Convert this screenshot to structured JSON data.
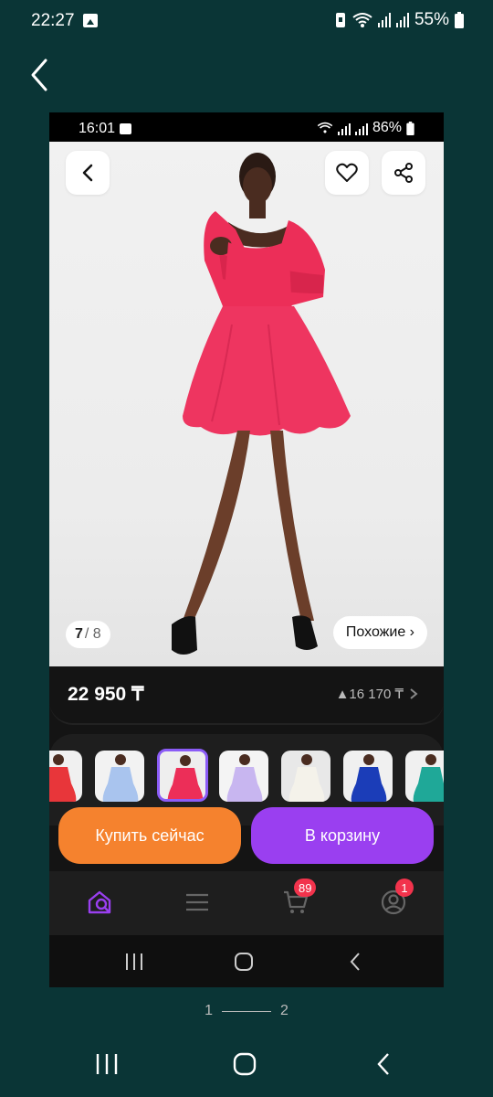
{
  "outer_status": {
    "time": "22:27",
    "battery": "55%"
  },
  "inner_status": {
    "time": "16:01",
    "battery": "86%"
  },
  "gallery": {
    "current": "7",
    "total": "/ 8",
    "similar_label": "Похожие ›"
  },
  "product": {
    "price": "22 950 ₸",
    "old_price": "▲16 170 ₸"
  },
  "actions": {
    "buy_now": "Купить сейчас",
    "add_to_cart": "В корзину"
  },
  "tabbar": {
    "cart_badge": "89",
    "profile_badge": "1"
  },
  "pager": {
    "page1": "1",
    "page2": "2"
  },
  "thumbnails": [
    {
      "color": "#e8363a",
      "bg": "#f0f0f0"
    },
    {
      "color": "#a9c4ee",
      "bg": "#f2f2f2"
    },
    {
      "color": "#ec2e58",
      "bg": "#eeeeee"
    },
    {
      "color": "#c8b6f0",
      "bg": "#f4f4f4"
    },
    {
      "color": "#f4f2ea",
      "bg": "#e8e8e8"
    },
    {
      "color": "#1b3db8",
      "bg": "#f0f0f0"
    },
    {
      "color": "#1fa898",
      "bg": "#f0f0f0"
    }
  ],
  "colors": {
    "accent_orange": "#f5822e",
    "accent_purple": "#9a3ff0",
    "badge": "#f2334c",
    "dress": "#ec2e58"
  }
}
